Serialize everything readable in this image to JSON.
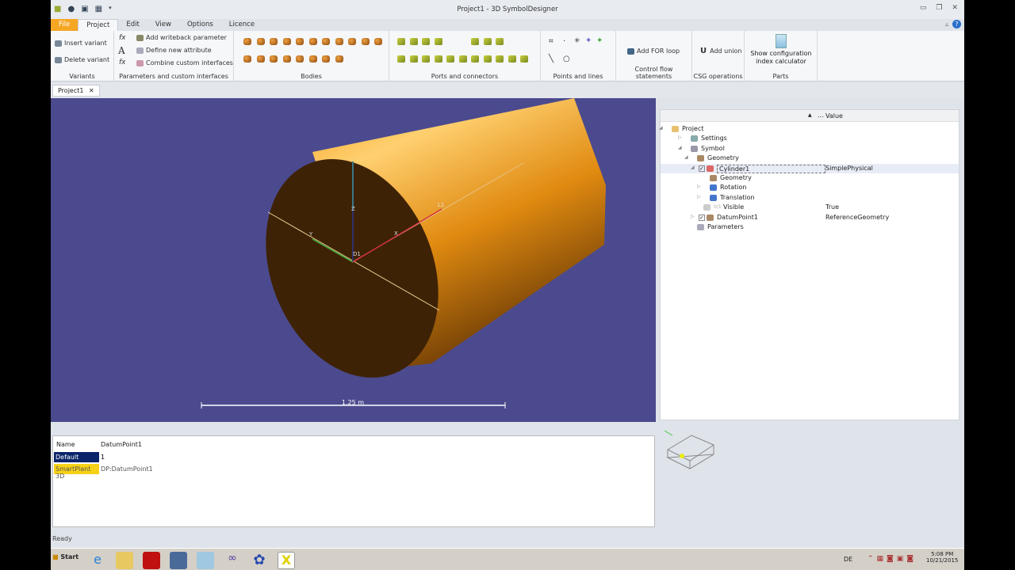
{
  "window": {
    "title": "Project1 - 3D SymbolDesigner"
  },
  "menu_tabs": [
    "File",
    "Project",
    "Edit",
    "View",
    "Options",
    "Licence"
  ],
  "ribbon": {
    "variants": {
      "label": "Variants",
      "insert": "Insert variant",
      "delete": "Delete variant"
    },
    "parameters": {
      "label": "Parameters and custom interfaces",
      "add_writeback": "Add writeback parameter",
      "define_attr": "Define new attribute",
      "combine": "Combine custom interfaces"
    },
    "bodies": {
      "label": "Bodies"
    },
    "ports": {
      "label": "Ports and connectors"
    },
    "points": {
      "label": "Points and lines"
    },
    "control": {
      "label": "Control flow statements",
      "add_for": "Add FOR loop"
    },
    "csg": {
      "label": "CSG operations",
      "add_union": "Add union"
    },
    "parts": {
      "label": "Parts",
      "show_calc": "Show configuration index calculator"
    }
  },
  "doc_tab": "Project1",
  "viewport": {
    "labels": {
      "z": "Z",
      "y": "Y",
      "x": "X",
      "d1": "D1",
      "l1": "L1"
    },
    "scale": "1.25 m",
    "background": "#4b4a8e",
    "body_color": "#f08c10"
  },
  "tree": {
    "value_header": "Value",
    "dots": "...",
    "items": [
      {
        "label": "Project",
        "value": ""
      },
      {
        "label": "Settings",
        "value": ""
      },
      {
        "label": "Symbol",
        "value": ""
      },
      {
        "label": "Geometry",
        "value": ""
      },
      {
        "label": "Cylinder1",
        "value": "SimplePhysical"
      },
      {
        "label": "Geometry",
        "value": ""
      },
      {
        "label": "Rotation",
        "value": ""
      },
      {
        "label": "Translation",
        "value": ""
      },
      {
        "label": "Visible",
        "value": "True",
        "prefix": "0/1"
      },
      {
        "label": "DatumPoint1",
        "value": "ReferenceGeometry"
      },
      {
        "label": "Parameters",
        "value": ""
      }
    ]
  },
  "properties": {
    "header_name": "Name",
    "header_value": "DatumPoint1",
    "rows": [
      {
        "name": "Default",
        "value": "1"
      },
      {
        "name": "SmartPlant 3D",
        "value": "DP:DatumPoint1"
      }
    ]
  },
  "status": "Ready",
  "taskbar": {
    "start": "Start",
    "lang": "DE",
    "time": "5:08 PM",
    "date": "10/21/2015"
  }
}
